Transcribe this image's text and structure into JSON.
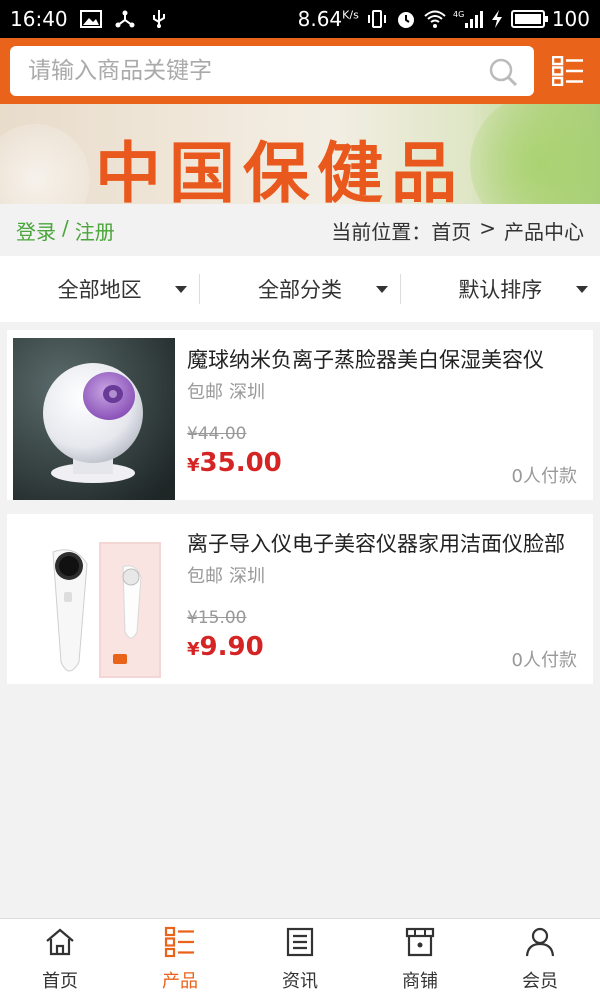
{
  "status_bar": {
    "time": "16:40",
    "network_speed": "8.64",
    "network_speed_unit": "K/s",
    "signal_label": "4G",
    "battery": "100",
    "battery_fraction": 1.0,
    "icons": [
      "image-icon",
      "share-icon",
      "usb-icon",
      "vibrate-icon",
      "alarm-icon",
      "wifi-icon",
      "signal-icon",
      "charging-icon",
      "battery-icon"
    ]
  },
  "search": {
    "placeholder": "请输入商品关键字",
    "value": ""
  },
  "banner": {
    "title": "中国保健品"
  },
  "breadcrumb": {
    "login": "登录",
    "separator": "/",
    "register": "注册",
    "location_label": "当前位置：",
    "home": "首页",
    "arrow": ">",
    "current": "产品中心"
  },
  "filters": [
    {
      "label": "全部地区"
    },
    {
      "label": "全部分类"
    },
    {
      "label": "默认排序"
    }
  ],
  "products": [
    {
      "name": "魔球纳米负离子蒸脸器美白保湿美容仪",
      "shipping": "包邮",
      "city": "深圳",
      "old_price": "¥44.00",
      "currency": "¥",
      "price": "35.00",
      "paid": "0人付款"
    },
    {
      "name": "离子导入仪电子美容仪器家用洁面仪脸部",
      "shipping": "包邮",
      "city": "深圳",
      "old_price": "¥15.00",
      "currency": "¥",
      "price": "9.90",
      "paid": "0人付款"
    }
  ],
  "bottom_nav": [
    {
      "label": "首页",
      "icon": "home-icon",
      "active": false
    },
    {
      "label": "产品",
      "icon": "product-list-icon",
      "active": true
    },
    {
      "label": "资讯",
      "icon": "news-icon",
      "active": false
    },
    {
      "label": "商铺",
      "icon": "shop-icon",
      "active": false
    },
    {
      "label": "会员",
      "icon": "member-icon",
      "active": false
    }
  ],
  "colors": {
    "brand_orange": "#e9631b",
    "price_red": "#d42424",
    "link_green": "#4aa53a"
  }
}
